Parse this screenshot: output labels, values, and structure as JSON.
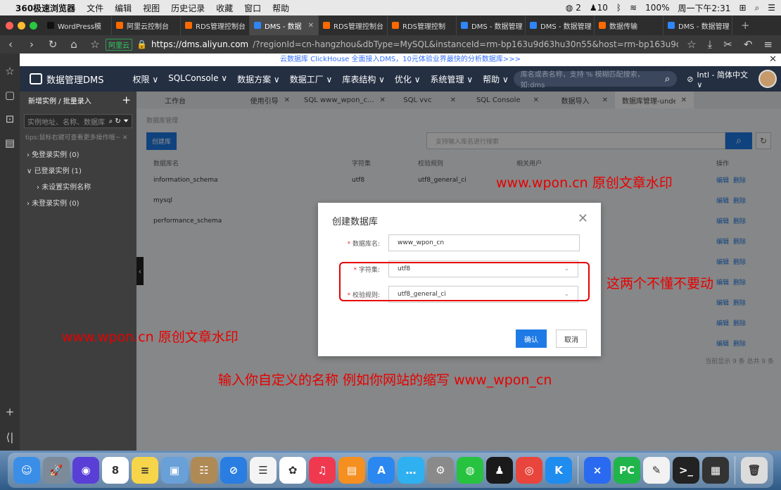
{
  "menubar": {
    "apple": "",
    "app": "360极速浏览器",
    "items": [
      "文件",
      "编辑",
      "视图",
      "历史记录",
      "收藏",
      "窗口",
      "帮助"
    ],
    "wechat_count": "2",
    "bell_count": "10",
    "battery": "100%",
    "clock": "周一下午2:31"
  },
  "tabs": [
    {
      "label": "WordPress模",
      "color": "#111"
    },
    {
      "label": "阿里云控制台",
      "color": "#ff6a00"
    },
    {
      "label": "RDS管理控制台",
      "color": "#ff6a00"
    },
    {
      "label": "DMS - 数据",
      "color": "#2f86f6",
      "active": true
    },
    {
      "label": "RDS管理控制台",
      "color": "#ff6a00"
    },
    {
      "label": "RDS管理控制",
      "color": "#ff6a00"
    },
    {
      "label": "DMS - 数据管理",
      "color": "#2f86f6"
    },
    {
      "label": "DMS - 数据管理",
      "color": "#2f86f6"
    },
    {
      "label": "数据传输",
      "color": "#ff6a00"
    },
    {
      "label": "DMS - 数据管理",
      "color": "#2f86f6"
    }
  ],
  "address": {
    "shield": "阿里云",
    "host": "https://dms.aliyun.com",
    "path": "/?regionId=cn-hangzhou&dbType=MySQL&instanceId=rm-bp163u9d63hu30n55&host=rm-bp163u9d63hu30n55.mysql.rds...."
  },
  "banner": "云数据库 ClickHouse 全面接入DMS，10元体验业界最快的分析数据库>>>",
  "app": {
    "title": "数据管理DMS",
    "nav": [
      "权限 ∨",
      "SQLConsole ∨",
      "数据方案 ∨",
      "数据工厂 ∨",
      "库表结构 ∨",
      "优化 ∨",
      "系统管理 ∨",
      "帮助 ∨"
    ],
    "search_placeholder": "库名或表名称，支持 % 模糊匹配搜索，如:dms",
    "user": "Intl - 简体中文 ∨"
  },
  "sidebar": {
    "header": "新增实例 / 批量录入",
    "search_placeholder": "实例地址、名称、数据库",
    "tips": "tips:鼠标右键可查看更多操作哦~",
    "tree": [
      "› 免登录实例 (0)",
      "∨ 已登录实例 (1)",
      "› 未设置实例名称",
      "› 未登录实例 (0)"
    ]
  },
  "worktabs": [
    "工作台",
    "使用引导",
    "SQL www_wpon_c...",
    "SQL vvc",
    "SQL Console",
    "数据导入",
    "数据库管理-undefined"
  ],
  "crumb": "数据库管理",
  "create_btn": "创建库",
  "table_search_placeholder": "支持输入库名进行搜索",
  "table": {
    "headers": [
      "数据库名",
      "字符集",
      "校验规则",
      "相关用户",
      "操作"
    ],
    "rows": [
      {
        "name": "information_schema",
        "charset": "utf8",
        "collation": "utf8_general_ci"
      },
      {
        "name": "mysql",
        "charset": "",
        "collation": ""
      },
      {
        "name": "performance_schema",
        "charset": "",
        "collation": ""
      },
      {
        "name": "",
        "charset": "",
        "collation": ""
      },
      {
        "name": "",
        "charset": "",
        "collation": ""
      },
      {
        "name": "",
        "charset": "",
        "collation": ""
      },
      {
        "name": "",
        "charset": "",
        "collation": ""
      },
      {
        "name": "",
        "charset": "",
        "collation": ""
      },
      {
        "name": "",
        "charset": "",
        "collation": ""
      }
    ],
    "ops_edit": "编辑",
    "ops_delete": "删除",
    "footer": "当前显示 9 条 总共 9 条"
  },
  "modal": {
    "title": "创建数据库",
    "db_label": "数据库名:",
    "db_value": "www_wpon_cn",
    "charset_label": "字符集:",
    "charset_value": "utf8",
    "collation_label": "校验规则:",
    "collation_value": "utf8_general_ci",
    "confirm": "确认",
    "cancel": "取消"
  },
  "annotations": {
    "watermark1": "www.wpon.cn 原创文章水印",
    "watermark2": "www.wpon.cn 原创文章水印",
    "hint1": "这两个不懂不要动",
    "hint2": "输入你自定义的名称 例如你网站的缩写 www_wpon_cn"
  },
  "dock": [
    {
      "name": "finder",
      "color": "#3a8ee6",
      "glyph": "☺"
    },
    {
      "name": "launchpad",
      "color": "#7d8a99",
      "glyph": "🚀"
    },
    {
      "name": "siri",
      "color": "#5a3fd6",
      "glyph": "◉"
    },
    {
      "name": "calendar",
      "color": "#ffffff",
      "glyph": "8"
    },
    {
      "name": "notes",
      "color": "#f7d54a",
      "glyph": "≡"
    },
    {
      "name": "preview",
      "color": "#6aa0d8",
      "glyph": "▣"
    },
    {
      "name": "contacts",
      "color": "#b08a55",
      "glyph": "☷"
    },
    {
      "name": "safari",
      "color": "#2a7de1",
      "glyph": "⊘"
    },
    {
      "name": "reminders",
      "color": "#f4f4f4",
      "glyph": "☰"
    },
    {
      "name": "photos",
      "color": "#ffffff",
      "glyph": "✿"
    },
    {
      "name": "music",
      "color": "#f0384f",
      "glyph": "♫"
    },
    {
      "name": "books",
      "color": "#f58f1f",
      "glyph": "▤"
    },
    {
      "name": "app-store",
      "color": "#2a88f0",
      "glyph": "A"
    },
    {
      "name": "messages",
      "color": "#2fb0f0",
      "glyph": "…"
    },
    {
      "name": "system-preferences",
      "color": "#8a8a8a",
      "glyph": "⚙"
    },
    {
      "name": "wechat",
      "color": "#27c23f",
      "glyph": "◍"
    },
    {
      "name": "qq",
      "color": "#1a1a1a",
      "glyph": "♟"
    },
    {
      "name": "chrome",
      "color": "#e8453c",
      "glyph": "◎"
    },
    {
      "name": "kde-connect",
      "color": "#1f8cf0",
      "glyph": "K"
    },
    {
      "name": "xcode",
      "color": "#2a6af0",
      "glyph": "⨯"
    },
    {
      "name": "pycharm",
      "color": "#1fb54a",
      "glyph": "PC"
    },
    {
      "name": "textedit",
      "color": "#f2f2f2",
      "glyph": "✎"
    },
    {
      "name": "terminal",
      "color": "#222222",
      "glyph": ">_"
    },
    {
      "name": "console",
      "color": "#333333",
      "glyph": "▦"
    },
    {
      "name": "trash",
      "color": "#dcdcdc",
      "glyph": "🗑"
    }
  ]
}
